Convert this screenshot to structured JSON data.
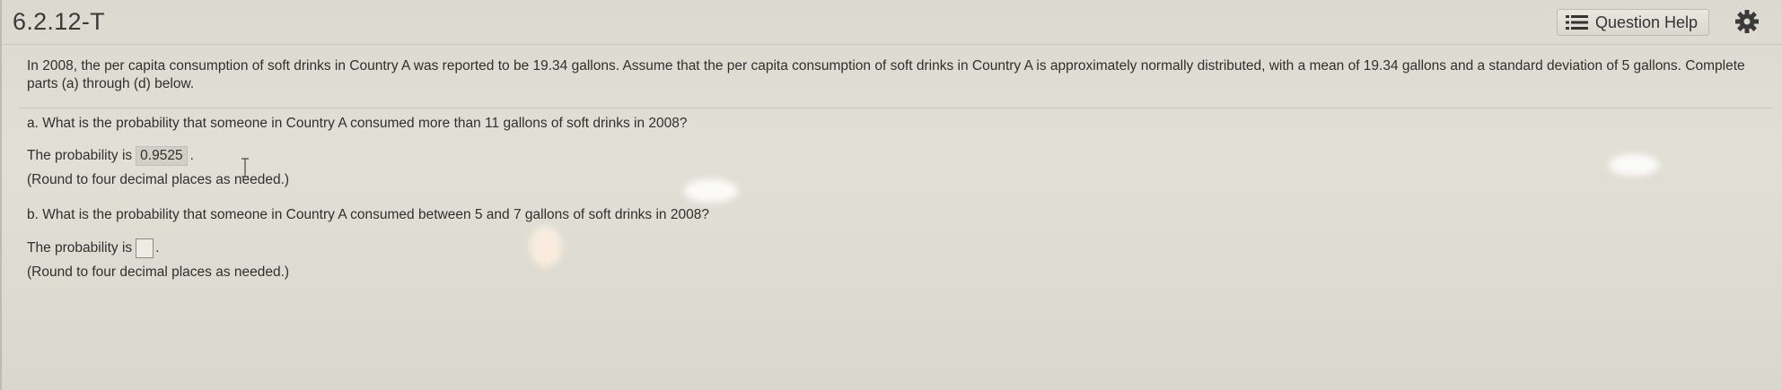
{
  "header": {
    "title": "6.2.12-T",
    "help_label": "Question Help"
  },
  "problem": {
    "intro": "In 2008, the per capita consumption of soft drinks in Country A was reported to be 19.34 gallons. Assume that the per capita consumption of soft drinks in Country A is approximately normally distributed, with a mean of 19.34 gallons and a standard deviation of 5 gallons. Complete parts (a) through (d) below.",
    "part_a": {
      "question": "a. What is the probability that someone in Country A consumed more than 11 gallons of soft drinks in 2008?",
      "answer_prefix": "The probability is",
      "answer_value": "0.9525",
      "answer_suffix": ".",
      "note": "(Round to four decimal places as needed.)"
    },
    "part_b": {
      "question": "b. What is the probability that someone in Country A consumed between 5 and 7 gallons of soft drinks in 2008?",
      "answer_prefix": "The probability is",
      "answer_value": "",
      "answer_suffix": ".",
      "note": "(Round to four decimal places as needed.)"
    }
  },
  "icons": {
    "help": "list-icon",
    "settings": "gear-icon"
  },
  "colors": {
    "background": "#dedcd2",
    "answer_highlight": "#d2d0c6"
  }
}
